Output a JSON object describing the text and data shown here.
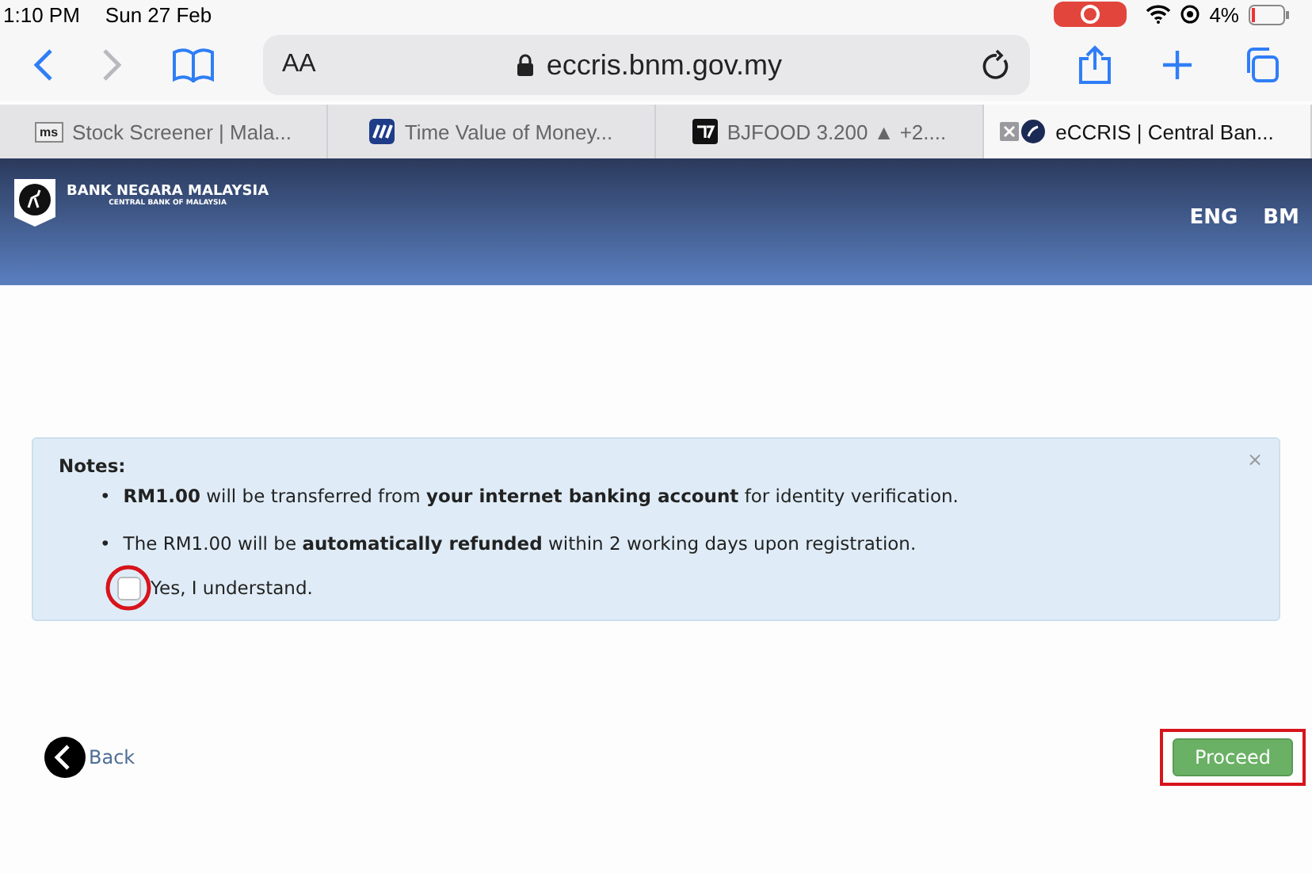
{
  "status_bar": {
    "time": "1:10 PM",
    "date": "Sun 27 Feb",
    "battery": "4%"
  },
  "address_bar": {
    "text_size": "AA",
    "url": "eccris.bnm.gov.my"
  },
  "tabs": [
    {
      "title": "Stock Screener | Mala...",
      "favicon": {
        "kind": "text",
        "text": "ms"
      },
      "selected": false
    },
    {
      "title": "Time Value of Money...",
      "favicon": {
        "kind": "chart"
      },
      "selected": false
    },
    {
      "title": "BJFOOD 3.200 ▲ +2....",
      "favicon": {
        "kind": "square"
      },
      "selected": false
    },
    {
      "title": "eCCRIS | Central Ban...",
      "favicon": {
        "kind": "globe"
      },
      "selected": true
    }
  ],
  "header": {
    "name": "BANK NEGARA MALAYSIA",
    "subtitle": "CENTRAL BANK OF MALAYSIA",
    "languages": [
      "ENG",
      "BM"
    ]
  },
  "notes": {
    "title": "Notes:",
    "close": "×",
    "bullet": "•",
    "items": [
      "**RM1.00** will be transferred from **your internet banking account** for identity verification.",
      "The RM1.00 will be **automatically refunded** within 2 working days upon registration."
    ],
    "checkbox": {
      "label": "Yes, I understand.",
      "checked": false
    }
  },
  "back": "Back",
  "proceed": "Proceed"
}
